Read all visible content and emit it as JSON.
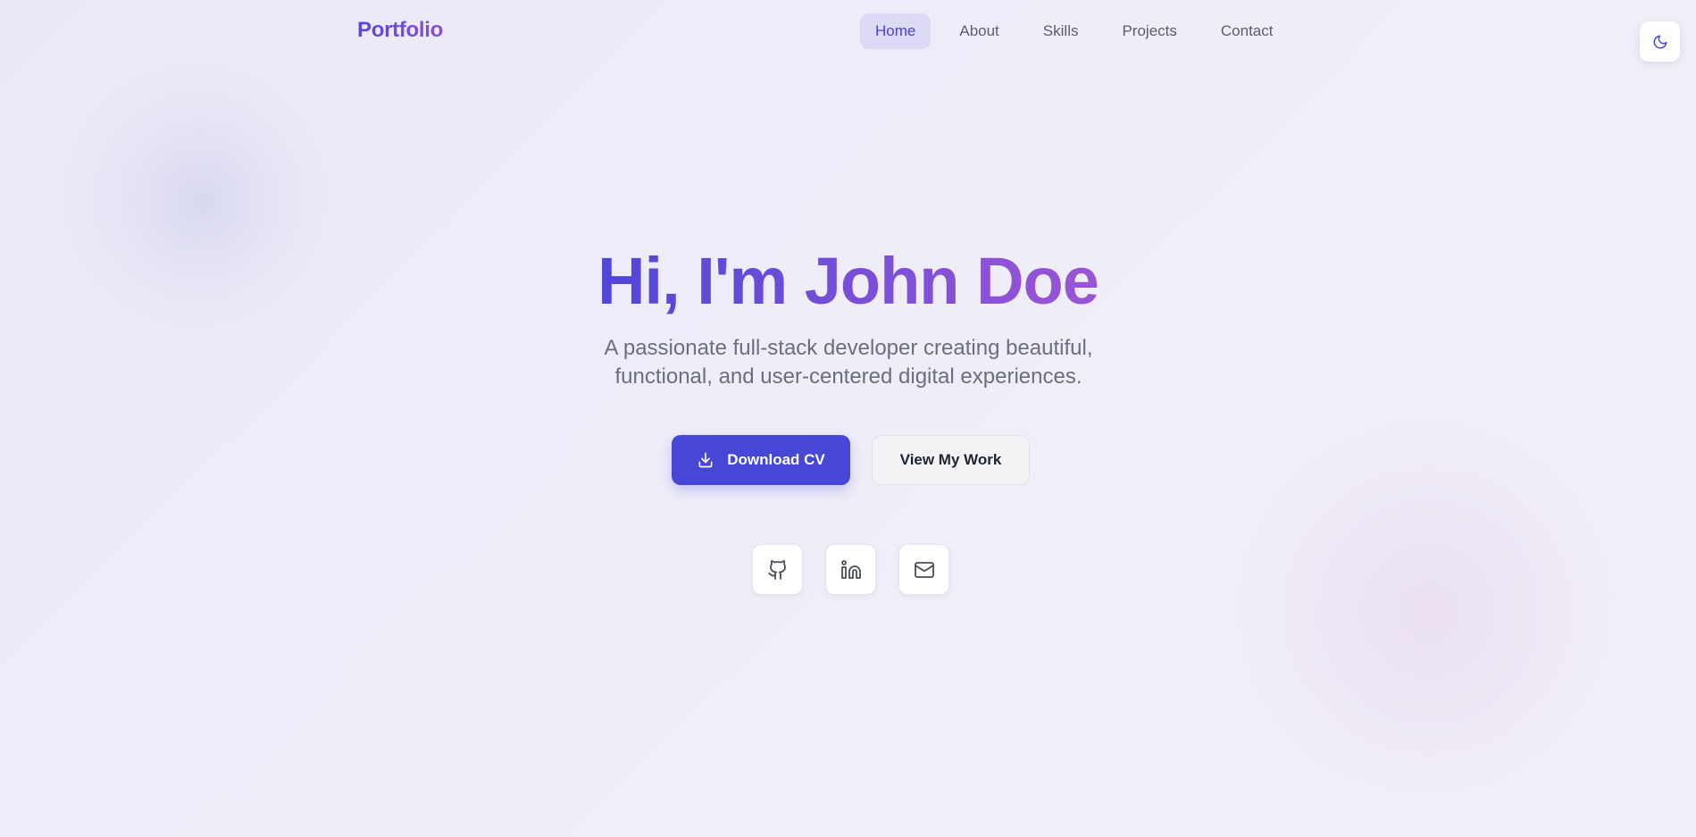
{
  "nav": {
    "logo": "Portfolio",
    "links": [
      {
        "label": "Home",
        "active": true
      },
      {
        "label": "About",
        "active": false
      },
      {
        "label": "Skills",
        "active": false
      },
      {
        "label": "Projects",
        "active": false
      },
      {
        "label": "Contact",
        "active": false
      }
    ],
    "theme_toggle_icon": "moon-icon"
  },
  "hero": {
    "title": "Hi, I'm John Doe",
    "subtitle": "A passionate full-stack developer creating beautiful, functional, and user-centered digital experiences.",
    "primary_button": {
      "label": "Download CV",
      "icon": "download-icon"
    },
    "secondary_button": {
      "label": "View My Work"
    },
    "socials": [
      {
        "icon": "github-icon"
      },
      {
        "icon": "linkedin-icon"
      },
      {
        "icon": "mail-icon"
      }
    ]
  },
  "colors": {
    "primary": "#4747d6",
    "active_nav_bg": "#dcdaf5",
    "gradient_start": "#4f46d8",
    "gradient_end": "#9b55d6",
    "text_muted": "#6b6e7c"
  }
}
